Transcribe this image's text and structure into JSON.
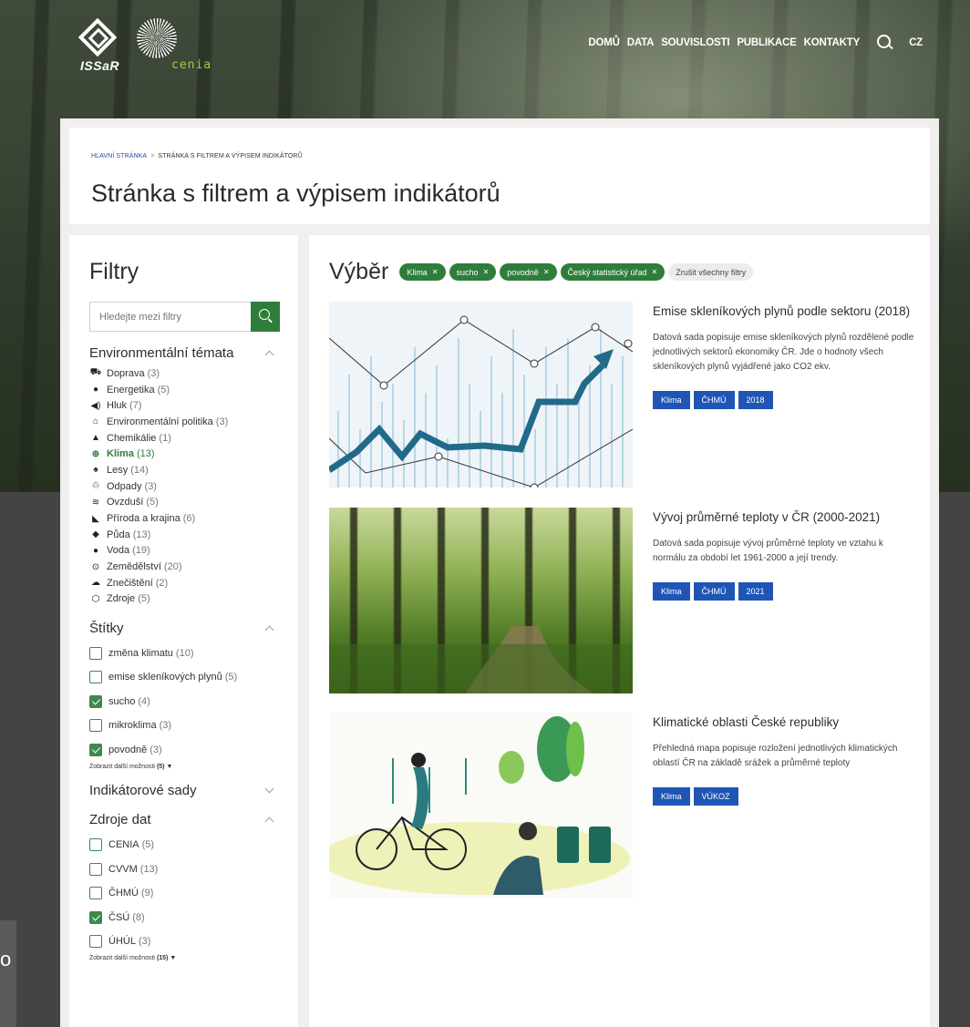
{
  "header": {
    "logo_issar": "ISSaR",
    "logo_cenia": "cenia",
    "nav": [
      "DOMŮ",
      "DATA",
      "SOUVISLOSTI",
      "PUBLIKACE",
      "KONTAKTY"
    ],
    "lang": "CZ"
  },
  "breadcrumb": {
    "home": "HLAVNÍ STRÁNKA",
    "separator": ">",
    "current": "STRÁNKA S FILTREM A VÝPISEM INDIKÁTORŮ"
  },
  "page_title": "Stránka s filtrem a výpisem indikátorů",
  "filters": {
    "title": "Filtry",
    "search_placeholder": "Hledejte mezi filtry",
    "env_topics": {
      "title": "Environmentální témata",
      "items": [
        {
          "label": "Doprava",
          "count": "(3)",
          "icon": "car-icon",
          "glyph": "⛟"
        },
        {
          "label": "Energetika",
          "count": "(5)",
          "icon": "lightbulb-icon",
          "glyph": "●"
        },
        {
          "label": "Hluk",
          "count": "(7)",
          "icon": "speaker-icon",
          "glyph": "◀)"
        },
        {
          "label": "Environmentální politika",
          "count": "(3)",
          "icon": "institution-icon",
          "glyph": "⌂"
        },
        {
          "label": "Chemikálie",
          "count": "(1)",
          "icon": "flask-icon",
          "glyph": "▲"
        },
        {
          "label": "Klima",
          "count": "(13)",
          "icon": "globe-icon",
          "glyph": "⊕",
          "active": true
        },
        {
          "label": "Lesy",
          "count": "(14)",
          "icon": "tree-icon",
          "glyph": "♠"
        },
        {
          "label": "Odpady",
          "count": "(3)",
          "icon": "recycle-icon",
          "glyph": "♲"
        },
        {
          "label": "Ovzduší",
          "count": "(5)",
          "icon": "wind-icon",
          "glyph": "≋"
        },
        {
          "label": "Příroda a krajina",
          "count": "(6)",
          "icon": "landscape-icon",
          "glyph": "◣"
        },
        {
          "label": "Půda",
          "count": "(13)",
          "icon": "soil-icon",
          "glyph": "◆"
        },
        {
          "label": "Voda",
          "count": "(19)",
          "icon": "drop-icon",
          "glyph": "●"
        },
        {
          "label": "Zemědělství",
          "count": "(20)",
          "icon": "tractor-icon",
          "glyph": "⊙"
        },
        {
          "label": "Znečištění",
          "count": "(2)",
          "icon": "pollution-icon",
          "glyph": "☁"
        },
        {
          "label": "Zdroje",
          "count": "(5)",
          "icon": "box-icon",
          "glyph": "⬡"
        }
      ]
    },
    "tags": {
      "title": "Štítky",
      "items": [
        {
          "label": "změna klimatu",
          "count": "(10)",
          "checked": false
        },
        {
          "label": "emise skleníkových plynů",
          "count": "(5)",
          "checked": false
        },
        {
          "label": "sucho",
          "count": "(4)",
          "checked": true
        },
        {
          "label": "mikroklima",
          "count": "(3)",
          "checked": false
        },
        {
          "label": "povodně",
          "count": "(3)",
          "checked": true
        }
      ],
      "more_label": "Zobrazit další možnosti",
      "more_count": "(5)"
    },
    "indicator_sets": {
      "title": "Indikátorové sady"
    },
    "sources": {
      "title": "Zdroje dat",
      "items": [
        {
          "label": "CENIA",
          "count": "(5)",
          "checked": false
        },
        {
          "label": "CVVM",
          "count": "(13)",
          "checked": false
        },
        {
          "label": "ČHMÚ",
          "count": "(9)",
          "checked": false
        },
        {
          "label": "ČSÚ",
          "count": "(8)",
          "checked": true
        },
        {
          "label": "ÚHÚL",
          "count": "(3)",
          "checked": false
        }
      ],
      "more_label": "Zobrazit další možnosti",
      "more_count": "(15)"
    }
  },
  "selection": {
    "title": "Výběr",
    "chips": [
      "Klima",
      "sucho",
      "povodně",
      "Český statistický úřad"
    ],
    "clear_label": "Zrušit všechny filtry"
  },
  "results": [
    {
      "title": "Emise skleníkových plynů podle sektoru (2018)",
      "description": "Datová sada popisuje emise skleníkových plynů rozdělené podle jednotlivých sektorů ekonomiky ČR. Jde o hodnoty všech skleníkových plynů vyjádřené jako CO2 ekv.",
      "tags": [
        "Klima",
        "ČHMÚ",
        "2018"
      ]
    },
    {
      "title": "Vývoj průměrné teploty v ČR (2000-2021)",
      "description": "Datová sada popisuje vývoj průměrné teploty ve vztahu k normálu za období let 1961-2000 a její trendy.",
      "tags": [
        "Klima",
        "ČHMÚ",
        "2021"
      ]
    },
    {
      "title": "Klimatické oblasti České republiky",
      "description": "Přehledná mapa popisuje rozložení jednotlivých klimatických oblastí ČR na základě srážek a průměrné teploty",
      "tags": [
        "Klima",
        "VÚKOZ"
      ]
    }
  ],
  "side_tab_text": "o",
  "colors": {
    "accent_green": "#2f7d3b",
    "tag_blue": "#1f55b5",
    "link_blue": "#1f4f9e"
  }
}
